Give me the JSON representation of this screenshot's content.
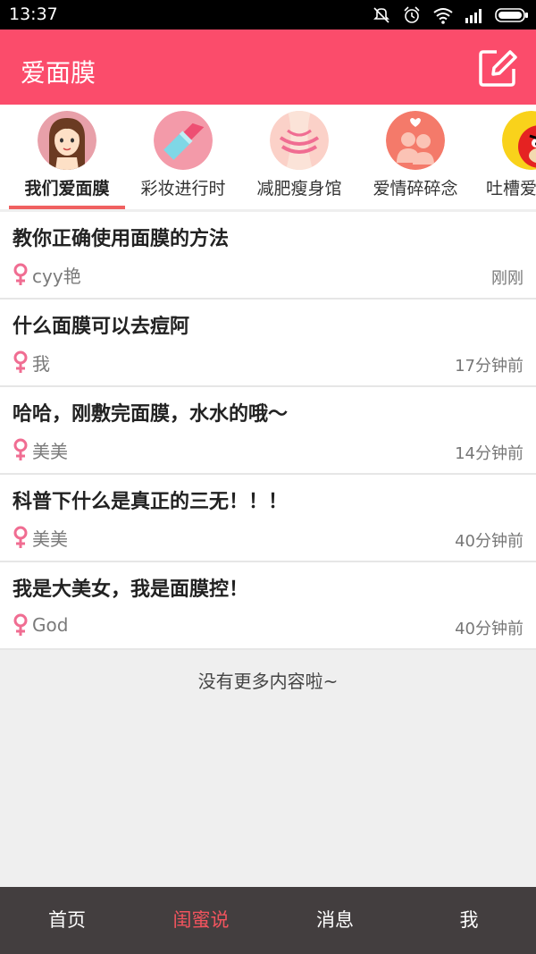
{
  "status_bar": {
    "time": "13:37",
    "icons": [
      "mute-icon",
      "alarm-icon",
      "wifi-icon",
      "signal-icon",
      "battery-icon"
    ]
  },
  "app_bar": {
    "title": "爱面膜",
    "action_icon": "compose-icon",
    "color": "#fb4c6b"
  },
  "tabs": [
    {
      "label": "我们爱面膜",
      "icon": "girl-avatar",
      "active": true
    },
    {
      "label": "彩妆进行时",
      "icon": "lipstick-icon",
      "active": false
    },
    {
      "label": "减肥瘦身馆",
      "icon": "waist-measure-icon",
      "active": false
    },
    {
      "label": "爱情碎碎念",
      "icon": "couple-icon",
      "active": false
    },
    {
      "label": "吐槽爱",
      "icon": "angry-bird-icon",
      "active": false
    }
  ],
  "posts": [
    {
      "title": "教你正确使用面膜的方法",
      "author": "cyy艳",
      "time": "刚刚"
    },
    {
      "title": "什么面膜可以去痘阿",
      "author": "我",
      "time": "17分钟前"
    },
    {
      "title": "哈哈，刚敷完面膜，水水的哦～",
      "author": "美美",
      "time": "14分钟前"
    },
    {
      "title": "科普下什么是真正的三无！！！",
      "author": "美美",
      "time": "40分钟前"
    },
    {
      "title": "我是大美女，我是面膜控！",
      "author": "God",
      "time": "40分钟前"
    }
  ],
  "end_message": "没有更多内容啦~",
  "bottom_nav": [
    {
      "label": "首页",
      "active": false
    },
    {
      "label": "闺蜜说",
      "active": true
    },
    {
      "label": "消息",
      "active": false
    },
    {
      "label": "我",
      "active": false
    }
  ],
  "colors": {
    "accent": "#fb4c6b",
    "female_icon": "#f06d92",
    "nav_active": "#f2545e",
    "nav_bg": "#433e3f"
  }
}
